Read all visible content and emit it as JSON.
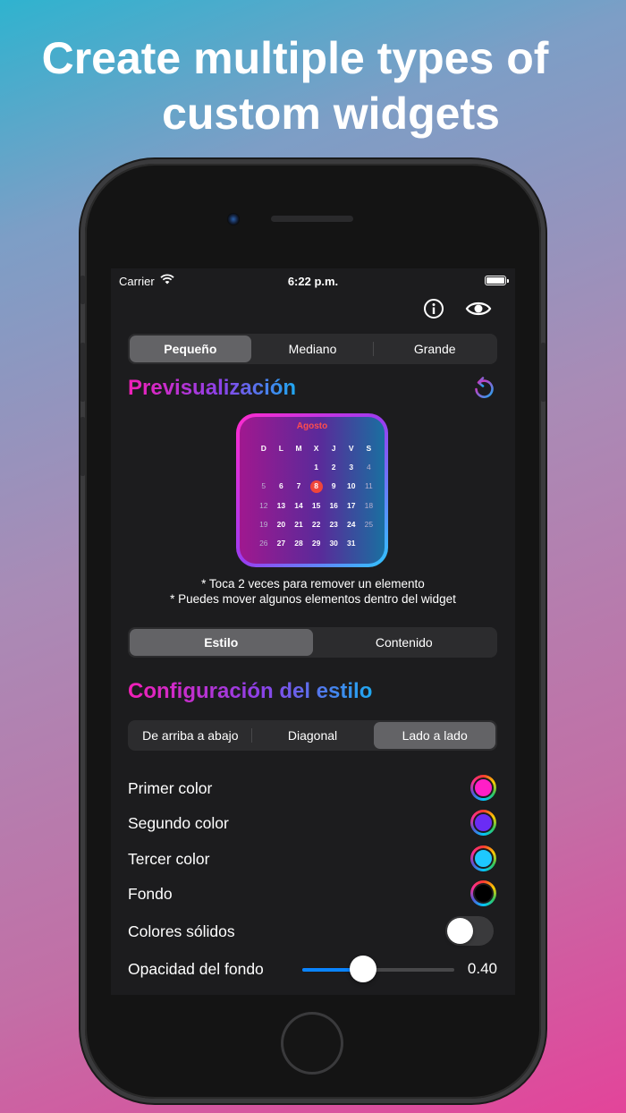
{
  "headline": {
    "line1": "Create multiple types of",
    "line2": "custom widgets"
  },
  "status_bar": {
    "carrier": "Carrier",
    "time": "6:22 p.m."
  },
  "nav": {
    "info_icon": "info-circle-icon",
    "preview_icon": "eye-icon"
  },
  "size_segment": {
    "options": [
      "Pequeño",
      "Mediano",
      "Grande"
    ],
    "selected": "Pequeño"
  },
  "preview": {
    "title": "Previsualización",
    "reset_icon": "rotate-ccw-icon",
    "widget": {
      "month": "Agosto",
      "weekdays": [
        "D",
        "L",
        "M",
        "X",
        "J",
        "V",
        "S"
      ],
      "weeks": [
        [
          "",
          "",
          "",
          "1",
          "2",
          "3",
          "4",
          "5"
        ],
        [
          "6",
          "7",
          "8",
          "9",
          "10",
          "11",
          "12"
        ],
        [
          "13",
          "14",
          "15",
          "16",
          "17",
          "18",
          "19"
        ],
        [
          "20",
          "21",
          "22",
          "23",
          "24",
          "25",
          "26"
        ],
        [
          "27",
          "28",
          "29",
          "30",
          "31",
          "",
          ""
        ]
      ],
      "today": "8",
      "colors": {
        "start": "#ff2bcd",
        "middle": "#9a3cf0",
        "end": "#2fc6ff",
        "today": "#f0453a",
        "month": "#ff4d4d"
      }
    },
    "hint1": "* Toca 2 veces para remover un elemento",
    "hint2": "* Puedes mover algunos elementos dentro del widget"
  },
  "mode_segment": {
    "options": [
      "Estilo",
      "Contenido"
    ],
    "selected": "Estilo"
  },
  "style_config": {
    "title": "Configuración del estilo",
    "direction_segment": {
      "options": [
        "De arriba a abajo",
        "Diagonal",
        "Lado a lado"
      ],
      "selected": "Lado a lado"
    },
    "first_color": {
      "label": "Primer color",
      "value": "#ff1fc7"
    },
    "second_color": {
      "label": "Segundo color",
      "value": "#6a2cf5"
    },
    "third_color": {
      "label": "Tercer color",
      "value": "#1ec8ff"
    },
    "background": {
      "label": "Fondo",
      "value": "#000000"
    },
    "solid_colors": {
      "label": "Colores sólidos",
      "on": false
    },
    "bg_opacity": {
      "label": "Opacidad del fondo",
      "value": 0.4,
      "display": "0.40"
    }
  }
}
